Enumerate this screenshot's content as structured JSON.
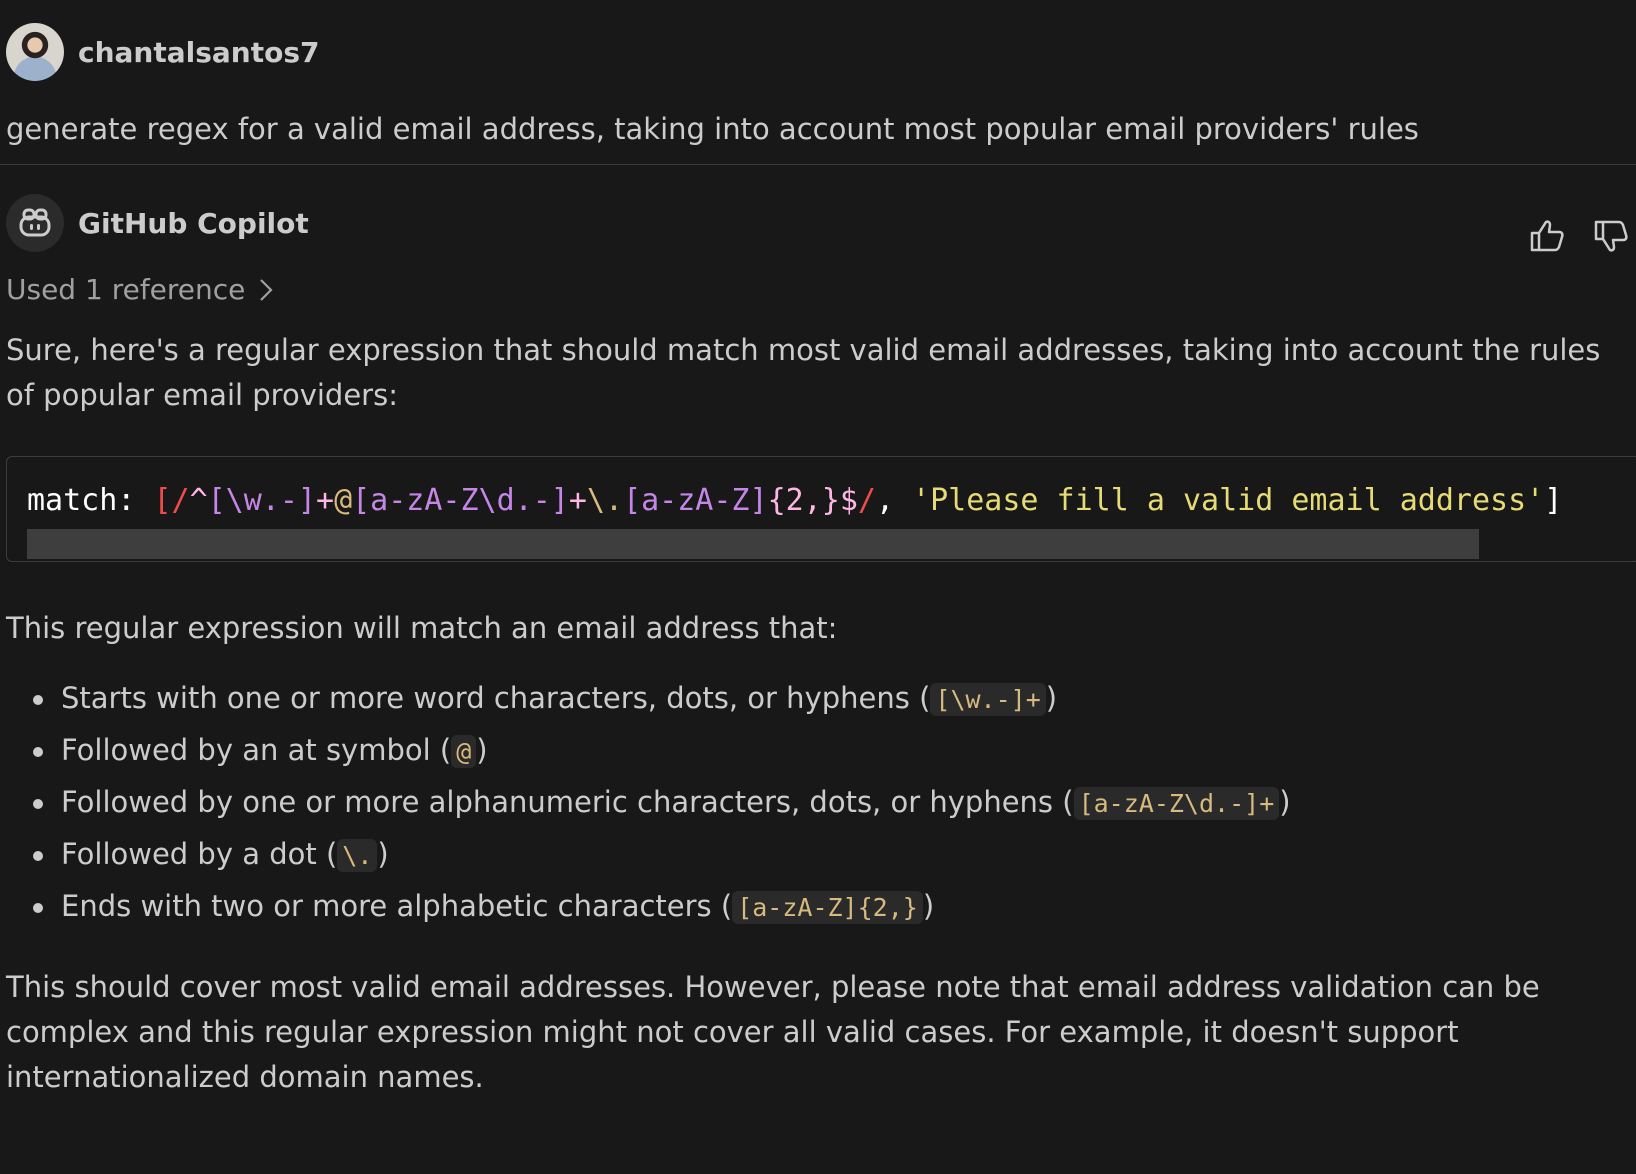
{
  "user_message": {
    "username": "chantalsantos7",
    "text": "generate regex for a valid email address, taking into account most popular email providers' rules"
  },
  "assistant": {
    "name": "GitHub Copilot",
    "icon": "copilot-icon",
    "reference_label": "Used 1 reference",
    "feedback_icons": [
      "thumbs-up-icon",
      "thumbs-down-icon"
    ],
    "intro": "Sure, here's a regular expression that should match most valid email addresses, taking into account the rules of popular email providers:",
    "code": {
      "key": "match:",
      "open_bracket": "[",
      "regex_open_slash": "/",
      "regex_caret": "^",
      "regex_part1": "[\\w.-]",
      "regex_plus1": "+",
      "regex_at": "@",
      "regex_part2": "[a-zA-Z\\d.-]",
      "regex_plus2": "+",
      "regex_dot": "\\.",
      "regex_part3": "[a-zA-Z]",
      "regex_quant": "{2,}",
      "regex_dollar": "$",
      "regex_close_slash": "/",
      "comma": ",",
      "message": "'Please fill a valid email address'",
      "close_bracket": "]"
    },
    "list_intro": "This regular expression will match an email address that:",
    "points": [
      {
        "text": "Starts with one or more word characters, dots, or hyphens (",
        "code": "[\\w.-]+",
        "close": ")"
      },
      {
        "text": "Followed by an at symbol (",
        "code": "@",
        "close": ")"
      },
      {
        "text": "Followed by one or more alphanumeric characters, dots, or hyphens (",
        "code": "[a-zA-Z\\d.-]+",
        "close": ")"
      },
      {
        "text": "Followed by a dot (",
        "code": "\\.",
        "close": ")"
      },
      {
        "text": "Ends with two or more alphabetic characters (",
        "code": "[a-zA-Z]{2,}",
        "close": ")"
      }
    ],
    "outro": "This should cover most valid email addresses. However, please note that email address validation can be complex and this regular expression might not cover all valid cases. For example, it doesn't support internationalized domain names."
  }
}
